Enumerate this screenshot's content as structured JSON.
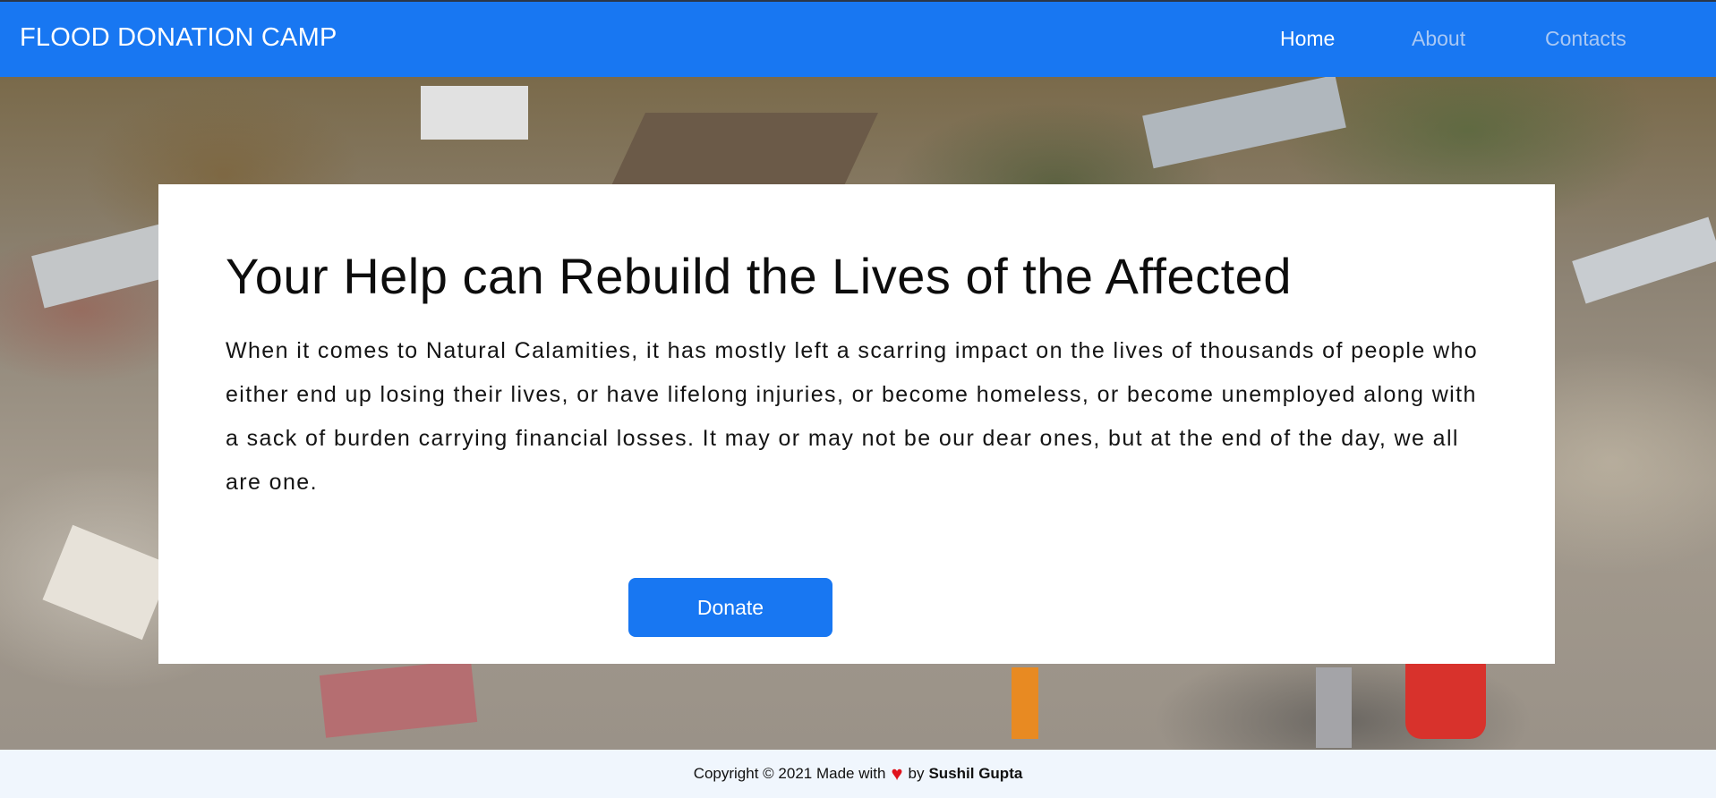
{
  "navbar": {
    "brand": "FLOOD DONATION CAMP",
    "links": [
      {
        "label": "Home",
        "active": true
      },
      {
        "label": "About",
        "active": false
      },
      {
        "label": "Contacts",
        "active": false
      }
    ]
  },
  "hero": {
    "title": "Your Help can Rebuild the Lives of the Affected",
    "body": "When it comes to Natural Calamities, it has mostly left a scarring impact on the lives of thousands of people who either end up losing their lives, or have lifelong injuries, or become homeless, or become unemployed along with a sack of burden carrying financial losses. It may or may not be our dear ones, but at the end of the day, we all are one.",
    "donate_label": "Donate"
  },
  "footer": {
    "prefix": "Copyright © 2021 Made with",
    "heart_icon": "heart-icon",
    "by": "by",
    "author": "Sushil Gupta"
  },
  "colors": {
    "primary": "#1877f2",
    "nav_inactive": "#a9c8f4",
    "footer_bg": "#f0f6fd",
    "heart": "#e0141e"
  }
}
